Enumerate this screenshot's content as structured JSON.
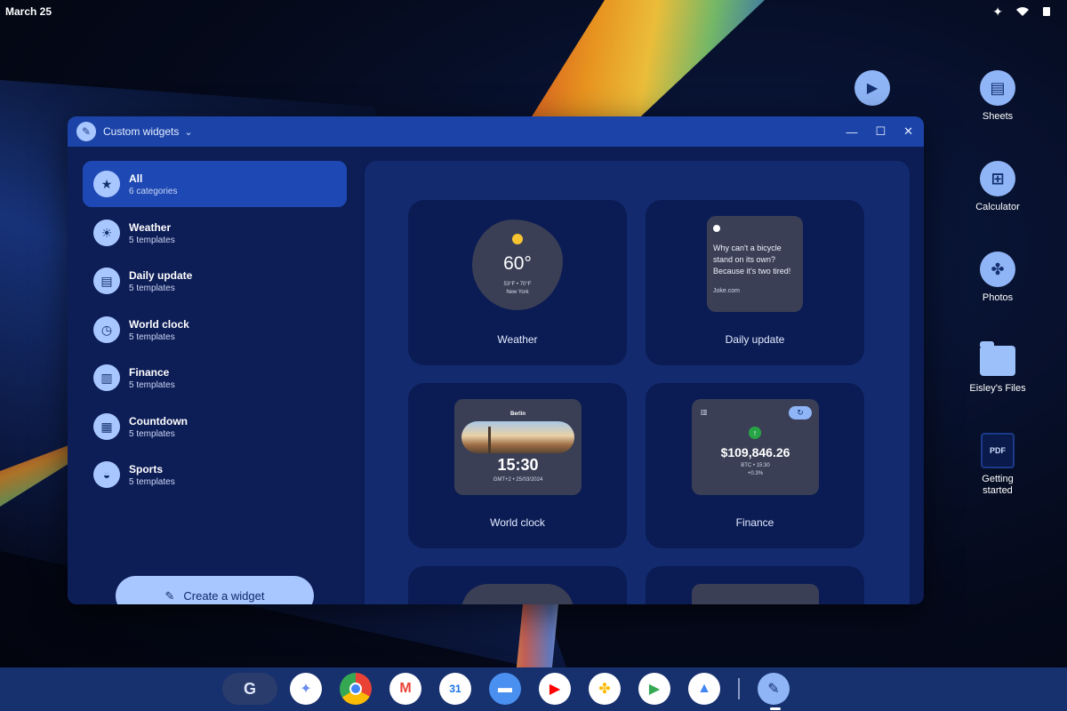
{
  "status": {
    "date": "March 25"
  },
  "desktop": {
    "icons": [
      {
        "label": "Sheets",
        "icon": "sheets-icon",
        "glyph": "▤"
      },
      {
        "label": "Calculator",
        "icon": "calculator-icon",
        "glyph": "⊞"
      },
      {
        "label": "Photos",
        "icon": "photos-icon",
        "glyph": "✤"
      },
      {
        "label": "Eisley's Files",
        "icon": "folder-icon"
      },
      {
        "label": "Getting started",
        "icon": "pdf-icon",
        "badge": "PDF"
      }
    ]
  },
  "window": {
    "title": "Custom widgets",
    "categories": [
      {
        "name": "All",
        "sub": "6 categories",
        "icon": "star-icon",
        "glyph": "★"
      },
      {
        "name": "Weather",
        "sub": "5 templates",
        "icon": "weather-icon",
        "glyph": "☀"
      },
      {
        "name": "Daily update",
        "sub": "5 templates",
        "icon": "news-icon",
        "glyph": "▤"
      },
      {
        "name": "World clock",
        "sub": "5 templates",
        "icon": "clock-icon",
        "glyph": "◷"
      },
      {
        "name": "Finance",
        "sub": "5 templates",
        "icon": "chart-icon",
        "glyph": "▥"
      },
      {
        "name": "Countdown",
        "sub": "5 templates",
        "icon": "calendar-icon",
        "glyph": "▦"
      },
      {
        "name": "Sports",
        "sub": "5 templates",
        "icon": "whistle-icon",
        "glyph": "◒"
      }
    ],
    "create_label": "Create a widget",
    "cards": {
      "weather": {
        "label": "Weather",
        "temp": "60°",
        "range": "53°F • 70°F",
        "city": "New York"
      },
      "daily": {
        "label": "Daily update",
        "text": "Why can't a bicycle stand on its own? Because it's two tired!",
        "source": "Joke.com"
      },
      "clock": {
        "label": "World clock",
        "city": "Berlin",
        "time": "15:30",
        "date": "GMT+2 • 25/03/2024"
      },
      "finance": {
        "label": "Finance",
        "value": "$109,846.26",
        "sub": "BTC • 15:30",
        "change": "+0.3%"
      }
    }
  },
  "dock": {
    "apps": [
      "Gemini",
      "Chrome",
      "Gmail",
      "Calendar",
      "Files",
      "YouTube",
      "Photos",
      "Play Store",
      "Drive"
    ]
  },
  "colors": {
    "accent": "#8fb5f7",
    "window_bg": "#0c1c55",
    "titlebar": "#1c44a8",
    "panel": "#132a6e"
  }
}
